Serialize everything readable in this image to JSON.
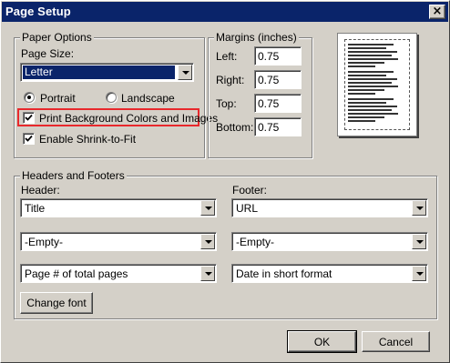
{
  "dialog": {
    "title": "Page Setup",
    "close_glyph": "×"
  },
  "paper_options": {
    "legend": "Paper Options",
    "page_size_label": "Page Size:",
    "page_size_value": "Letter",
    "orientation": {
      "portrait_label": "Portrait",
      "landscape_label": "Landscape",
      "selected": "Portrait"
    },
    "print_background": {
      "label": "Print Background Colors and Images",
      "checked": true
    },
    "shrink_to_fit": {
      "label": "Enable Shrink-to-Fit",
      "checked": true
    }
  },
  "margins": {
    "legend": "Margins (inches)",
    "left_label": "Left:",
    "left_value": "0.75",
    "right_label": "Right:",
    "right_value": "0.75",
    "top_label": "Top:",
    "top_value": "0.75",
    "bottom_label": "Bottom:",
    "bottom_value": "0.75"
  },
  "headers_footers": {
    "legend": "Headers and Footers",
    "header_label": "Header:",
    "footer_label": "Footer:",
    "header_1": "Title",
    "header_2": "-Empty-",
    "header_3": "Page # of total pages",
    "footer_1": "URL",
    "footer_2": "-Empty-",
    "footer_3": "Date in short format",
    "change_font_label": "Change font"
  },
  "buttons": {
    "ok_label": "OK",
    "cancel_label": "Cancel"
  },
  "colors": {
    "title_bar": "#0a246a",
    "dialog_face": "#d4d0c8",
    "highlight_box": "#e8282c"
  },
  "icons": {
    "close": "close-icon",
    "dropdown": "chevron-down-icon",
    "check": "check-icon"
  }
}
